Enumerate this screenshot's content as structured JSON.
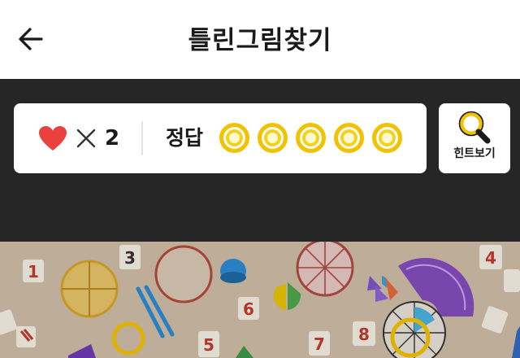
{
  "header": {
    "title": "틀린그림찾기",
    "back_icon": "arrow-left-icon"
  },
  "status": {
    "lives_icon": "heart-icon",
    "lives_multiplier": "×",
    "lives_count": "2",
    "answer_label": "정답",
    "answer_slots_total": 5,
    "answer_slots_found": 0
  },
  "hint": {
    "label": "힌트보기",
    "icon": "magnifier-icon"
  },
  "picture": {
    "number_tiles": [
      "1",
      "3",
      "4",
      "6",
      "7",
      "5",
      "8"
    ]
  },
  "colors": {
    "heart": "#e8413e",
    "slot": "#f2c200",
    "background": "#262626",
    "card": "#ffffff"
  }
}
